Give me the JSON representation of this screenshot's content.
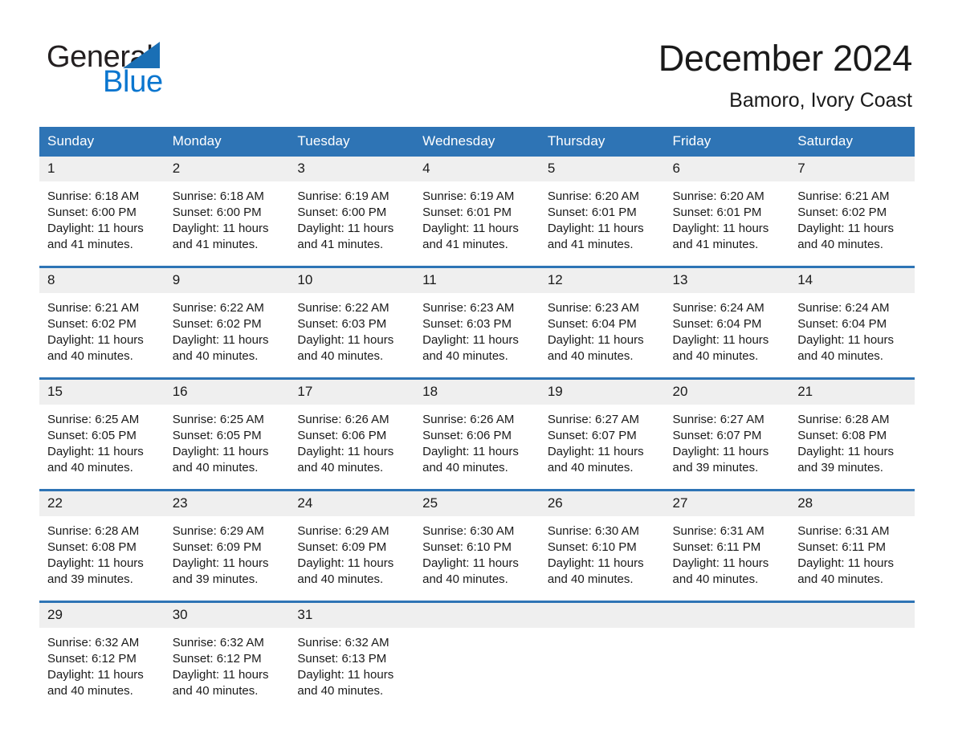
{
  "brand": {
    "name_top": "General",
    "name_bottom": "Blue",
    "triangle_color": "#1a6fb5",
    "blue_text_color": "#0b76cf"
  },
  "header": {
    "title": "December 2024",
    "subtitle": "Bamoro, Ivory Coast"
  },
  "theme": {
    "header_blue": "#2e74b5",
    "daynum_bg": "#efefef",
    "page_bg": "#ffffff",
    "text": "#1a1a1a"
  },
  "calendar": {
    "weekday_headers": [
      "Sunday",
      "Monday",
      "Tuesday",
      "Wednesday",
      "Thursday",
      "Friday",
      "Saturday"
    ],
    "weeks": [
      [
        {
          "day": "1",
          "sunrise": "Sunrise: 6:18 AM",
          "sunset": "Sunset: 6:00 PM",
          "daylight_1": "Daylight: 11 hours",
          "daylight_2": "and 41 minutes."
        },
        {
          "day": "2",
          "sunrise": "Sunrise: 6:18 AM",
          "sunset": "Sunset: 6:00 PM",
          "daylight_1": "Daylight: 11 hours",
          "daylight_2": "and 41 minutes."
        },
        {
          "day": "3",
          "sunrise": "Sunrise: 6:19 AM",
          "sunset": "Sunset: 6:00 PM",
          "daylight_1": "Daylight: 11 hours",
          "daylight_2": "and 41 minutes."
        },
        {
          "day": "4",
          "sunrise": "Sunrise: 6:19 AM",
          "sunset": "Sunset: 6:01 PM",
          "daylight_1": "Daylight: 11 hours",
          "daylight_2": "and 41 minutes."
        },
        {
          "day": "5",
          "sunrise": "Sunrise: 6:20 AM",
          "sunset": "Sunset: 6:01 PM",
          "daylight_1": "Daylight: 11 hours",
          "daylight_2": "and 41 minutes."
        },
        {
          "day": "6",
          "sunrise": "Sunrise: 6:20 AM",
          "sunset": "Sunset: 6:01 PM",
          "daylight_1": "Daylight: 11 hours",
          "daylight_2": "and 41 minutes."
        },
        {
          "day": "7",
          "sunrise": "Sunrise: 6:21 AM",
          "sunset": "Sunset: 6:02 PM",
          "daylight_1": "Daylight: 11 hours",
          "daylight_2": "and 40 minutes."
        }
      ],
      [
        {
          "day": "8",
          "sunrise": "Sunrise: 6:21 AM",
          "sunset": "Sunset: 6:02 PM",
          "daylight_1": "Daylight: 11 hours",
          "daylight_2": "and 40 minutes."
        },
        {
          "day": "9",
          "sunrise": "Sunrise: 6:22 AM",
          "sunset": "Sunset: 6:02 PM",
          "daylight_1": "Daylight: 11 hours",
          "daylight_2": "and 40 minutes."
        },
        {
          "day": "10",
          "sunrise": "Sunrise: 6:22 AM",
          "sunset": "Sunset: 6:03 PM",
          "daylight_1": "Daylight: 11 hours",
          "daylight_2": "and 40 minutes."
        },
        {
          "day": "11",
          "sunrise": "Sunrise: 6:23 AM",
          "sunset": "Sunset: 6:03 PM",
          "daylight_1": "Daylight: 11 hours",
          "daylight_2": "and 40 minutes."
        },
        {
          "day": "12",
          "sunrise": "Sunrise: 6:23 AM",
          "sunset": "Sunset: 6:04 PM",
          "daylight_1": "Daylight: 11 hours",
          "daylight_2": "and 40 minutes."
        },
        {
          "day": "13",
          "sunrise": "Sunrise: 6:24 AM",
          "sunset": "Sunset: 6:04 PM",
          "daylight_1": "Daylight: 11 hours",
          "daylight_2": "and 40 minutes."
        },
        {
          "day": "14",
          "sunrise": "Sunrise: 6:24 AM",
          "sunset": "Sunset: 6:04 PM",
          "daylight_1": "Daylight: 11 hours",
          "daylight_2": "and 40 minutes."
        }
      ],
      [
        {
          "day": "15",
          "sunrise": "Sunrise: 6:25 AM",
          "sunset": "Sunset: 6:05 PM",
          "daylight_1": "Daylight: 11 hours",
          "daylight_2": "and 40 minutes."
        },
        {
          "day": "16",
          "sunrise": "Sunrise: 6:25 AM",
          "sunset": "Sunset: 6:05 PM",
          "daylight_1": "Daylight: 11 hours",
          "daylight_2": "and 40 minutes."
        },
        {
          "day": "17",
          "sunrise": "Sunrise: 6:26 AM",
          "sunset": "Sunset: 6:06 PM",
          "daylight_1": "Daylight: 11 hours",
          "daylight_2": "and 40 minutes."
        },
        {
          "day": "18",
          "sunrise": "Sunrise: 6:26 AM",
          "sunset": "Sunset: 6:06 PM",
          "daylight_1": "Daylight: 11 hours",
          "daylight_2": "and 40 minutes."
        },
        {
          "day": "19",
          "sunrise": "Sunrise: 6:27 AM",
          "sunset": "Sunset: 6:07 PM",
          "daylight_1": "Daylight: 11 hours",
          "daylight_2": "and 40 minutes."
        },
        {
          "day": "20",
          "sunrise": "Sunrise: 6:27 AM",
          "sunset": "Sunset: 6:07 PM",
          "daylight_1": "Daylight: 11 hours",
          "daylight_2": "and 39 minutes."
        },
        {
          "day": "21",
          "sunrise": "Sunrise: 6:28 AM",
          "sunset": "Sunset: 6:08 PM",
          "daylight_1": "Daylight: 11 hours",
          "daylight_2": "and 39 minutes."
        }
      ],
      [
        {
          "day": "22",
          "sunrise": "Sunrise: 6:28 AM",
          "sunset": "Sunset: 6:08 PM",
          "daylight_1": "Daylight: 11 hours",
          "daylight_2": "and 39 minutes."
        },
        {
          "day": "23",
          "sunrise": "Sunrise: 6:29 AM",
          "sunset": "Sunset: 6:09 PM",
          "daylight_1": "Daylight: 11 hours",
          "daylight_2": "and 39 minutes."
        },
        {
          "day": "24",
          "sunrise": "Sunrise: 6:29 AM",
          "sunset": "Sunset: 6:09 PM",
          "daylight_1": "Daylight: 11 hours",
          "daylight_2": "and 40 minutes."
        },
        {
          "day": "25",
          "sunrise": "Sunrise: 6:30 AM",
          "sunset": "Sunset: 6:10 PM",
          "daylight_1": "Daylight: 11 hours",
          "daylight_2": "and 40 minutes."
        },
        {
          "day": "26",
          "sunrise": "Sunrise: 6:30 AM",
          "sunset": "Sunset: 6:10 PM",
          "daylight_1": "Daylight: 11 hours",
          "daylight_2": "and 40 minutes."
        },
        {
          "day": "27",
          "sunrise": "Sunrise: 6:31 AM",
          "sunset": "Sunset: 6:11 PM",
          "daylight_1": "Daylight: 11 hours",
          "daylight_2": "and 40 minutes."
        },
        {
          "day": "28",
          "sunrise": "Sunrise: 6:31 AM",
          "sunset": "Sunset: 6:11 PM",
          "daylight_1": "Daylight: 11 hours",
          "daylight_2": "and 40 minutes."
        }
      ],
      [
        {
          "day": "29",
          "sunrise": "Sunrise: 6:32 AM",
          "sunset": "Sunset: 6:12 PM",
          "daylight_1": "Daylight: 11 hours",
          "daylight_2": "and 40 minutes."
        },
        {
          "day": "30",
          "sunrise": "Sunrise: 6:32 AM",
          "sunset": "Sunset: 6:12 PM",
          "daylight_1": "Daylight: 11 hours",
          "daylight_2": "and 40 minutes."
        },
        {
          "day": "31",
          "sunrise": "Sunrise: 6:32 AM",
          "sunset": "Sunset: 6:13 PM",
          "daylight_1": "Daylight: 11 hours",
          "daylight_2": "and 40 minutes."
        },
        {
          "day": "",
          "sunrise": "",
          "sunset": "",
          "daylight_1": "",
          "daylight_2": ""
        },
        {
          "day": "",
          "sunrise": "",
          "sunset": "",
          "daylight_1": "",
          "daylight_2": ""
        },
        {
          "day": "",
          "sunrise": "",
          "sunset": "",
          "daylight_1": "",
          "daylight_2": ""
        },
        {
          "day": "",
          "sunrise": "",
          "sunset": "",
          "daylight_1": "",
          "daylight_2": ""
        }
      ]
    ]
  }
}
